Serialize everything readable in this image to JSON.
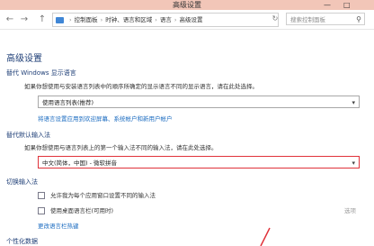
{
  "window": {
    "title": "高级设置",
    "minimize": "—",
    "maximize": "□"
  },
  "nav": {
    "back": "←",
    "forward": "→",
    "up": "↑",
    "breadcrumb": [
      "控制面板",
      "时钟、语言和区域",
      "语言",
      "高级设置"
    ],
    "refresh": "↻",
    "search_placeholder": "搜索控制面板"
  },
  "page": {
    "title": "高级设置"
  },
  "display_language": {
    "heading": "替代 Windows 显示语言",
    "description": "如果你想使用与安装语言列表中的顺序所确定的显示语言不同的显示语言，请在此处选择。",
    "selected": "使用语言列表(推荐)",
    "link": "将语言设置应用到欢迎屏幕、系统帐户和新用户帐户"
  },
  "input_method": {
    "heading": "替代默认输入法",
    "description": "如果你想使用与语言列表上的第一个输入法不同的输入法，请在此处选择。",
    "selected": "中文(简体，中国) - 微软拼音"
  },
  "switch_input": {
    "heading": "切换输入法",
    "option1": "允许我为每个应用窗口设置不同的输入法",
    "option2": "使用桌面语言栏(可用时)",
    "options_link": "选项",
    "hotkeys_link": "更改语言栏热键"
  },
  "personalization": {
    "heading": "个性化数据"
  },
  "colors": {
    "titlebar": "#f2c6b8",
    "highlight": "#e0323a",
    "link": "#1a6bc0",
    "heading": "#1f3f77"
  }
}
